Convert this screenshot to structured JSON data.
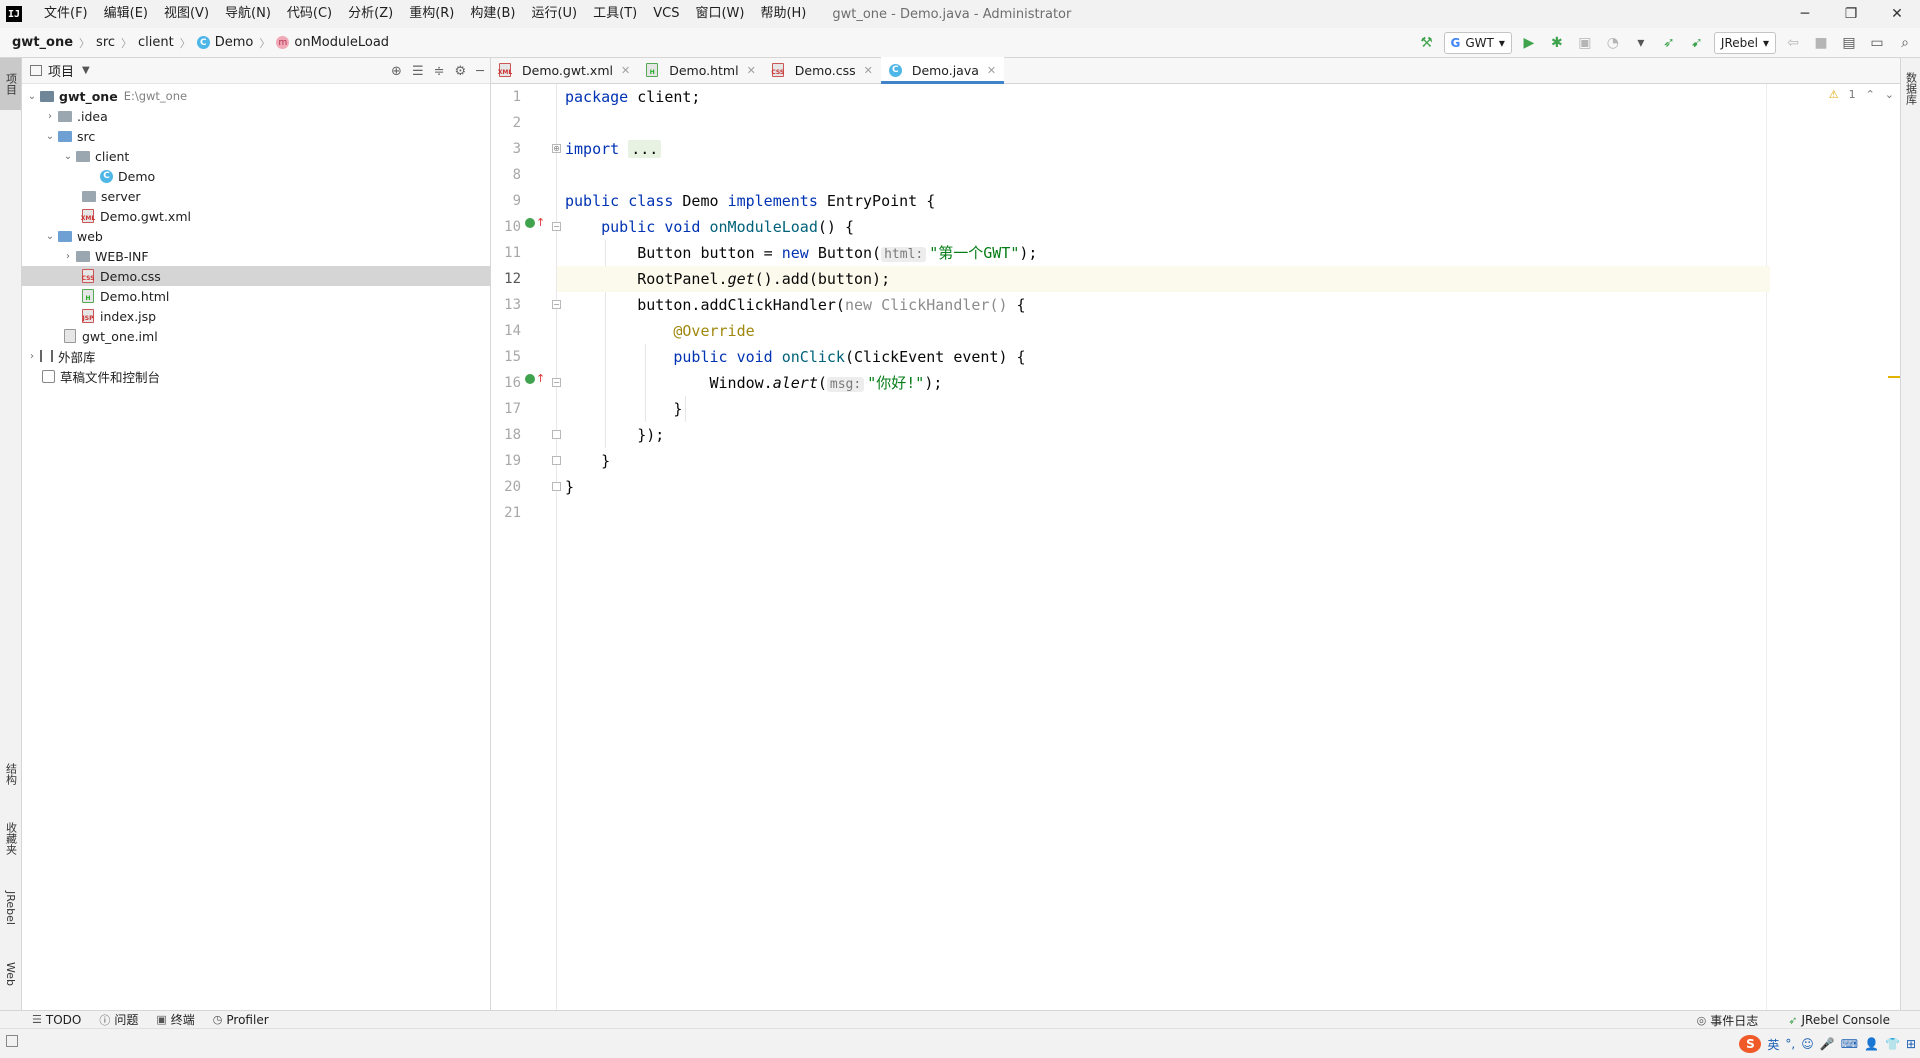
{
  "app": {
    "title": "gwt_one - Demo.java - Administrator",
    "logo": "IJ"
  },
  "menu": [
    "文件(F)",
    "编辑(E)",
    "视图(V)",
    "导航(N)",
    "代码(C)",
    "分析(Z)",
    "重构(R)",
    "构建(B)",
    "运行(U)",
    "工具(T)",
    "VCS",
    "窗口(W)",
    "帮助(H)"
  ],
  "window_controls": {
    "minimize": "─",
    "restore": "❐",
    "close": "✕"
  },
  "breadcrumb": {
    "project": "gwt_one",
    "dir1": "src",
    "dir2": "client",
    "cls": "Demo",
    "method": "onModuleLoad"
  },
  "toolbar": {
    "run_config": "GWT",
    "jrebel_config": "JRebel"
  },
  "left_strip": {
    "project": "项目",
    "structure": "结构",
    "favorites": "收藏夹",
    "jrebel": "JRebel",
    "web": "Web"
  },
  "right_strip": {
    "database": "数据库"
  },
  "project_panel": {
    "title": "项目",
    "tree": [
      {
        "label": "gwt_one",
        "hint": "E:\\gwt_one"
      },
      {
        "label": ".idea"
      },
      {
        "label": "src"
      },
      {
        "label": "client"
      },
      {
        "label": "Demo"
      },
      {
        "label": "server"
      },
      {
        "label": "Demo.gwt.xml"
      },
      {
        "label": "web"
      },
      {
        "label": "WEB-INF"
      },
      {
        "label": "Demo.css"
      },
      {
        "label": "Demo.html"
      },
      {
        "label": "index.jsp"
      },
      {
        "label": "gwt_one.iml"
      },
      {
        "label": "外部库"
      },
      {
        "label": "草稿文件和控制台"
      }
    ]
  },
  "tabs": [
    {
      "label": "Demo.gwt.xml"
    },
    {
      "label": "Demo.html"
    },
    {
      "label": "Demo.css"
    },
    {
      "label": "Demo.java"
    }
  ],
  "editor": {
    "line_numbers": [
      "1",
      "2",
      "3",
      "8",
      "9",
      "10",
      "11",
      "12",
      "13",
      "14",
      "15",
      "16",
      "17",
      "18",
      "19",
      "20",
      "21"
    ],
    "inspection_count": "1",
    "code": {
      "l1_kw": "package",
      "l1_rest": " client;",
      "l3_kw": "import",
      "l3_rest": "...",
      "l9_kw1": "public",
      "l9_kw2": "class",
      "l9_name": " Demo ",
      "l9_kw3": "implements",
      "l9_rest": " EntryPoint {",
      "l10_kw1": "public",
      "l10_kw2": "void",
      "l10_fn": "onModuleLoad",
      "l10_rest": "() {",
      "l11_a": "Button button = ",
      "l11_kw": "new",
      "l11_b": " Button(",
      "l11_hint": "html:",
      "l11_str": "\"第一个GWT\"",
      "l11_c": ");",
      "l12_a": "RootPanel.",
      "l12_it": "get",
      "l12_b": "().add(button);",
      "l13_a": "button.addClickHandler(",
      "l13_dim": "new ClickHandler()",
      "l13_b": " {",
      "l14_ann": "@Override",
      "l15_kw1": "public",
      "l15_kw2": "void",
      "l15_fn": "onClick",
      "l15_rest": "(ClickEvent event) {",
      "l16_a": "Window.",
      "l16_it": "alert",
      "l16_b": "(",
      "l16_hint": "msg:",
      "l16_str": "\"你好!\"",
      "l16_c": ");",
      "l17": "}",
      "l18": "});",
      "l19": "}",
      "l20": "}"
    }
  },
  "bottom_tabs": {
    "todo": "TODO",
    "problems": "问题",
    "terminal": "终端",
    "profiler": "Profiler",
    "event_log": "事件日志",
    "jrebel_console": "JRebel Console"
  },
  "tray": {
    "ime": "英"
  }
}
